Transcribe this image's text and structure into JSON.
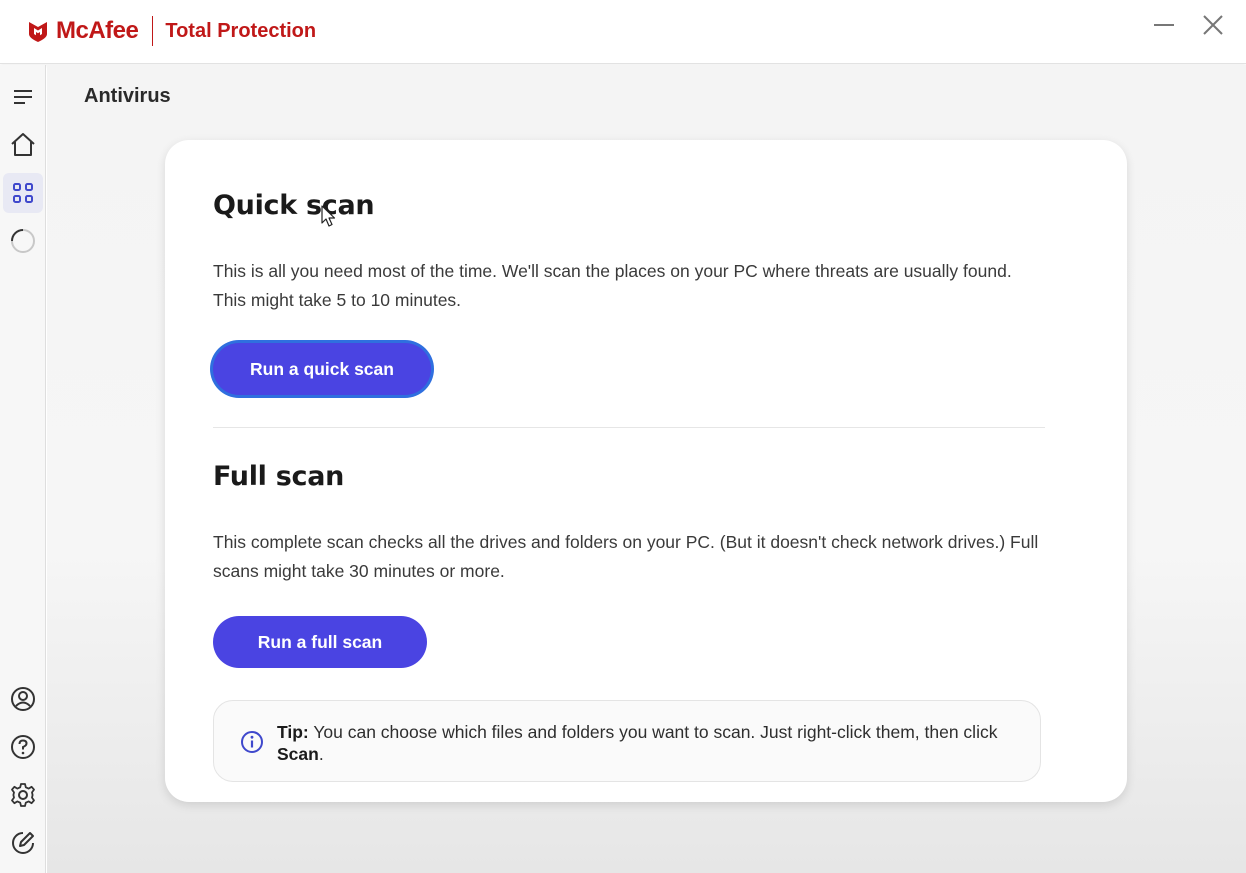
{
  "titlebar": {
    "brand_name": "McAfee",
    "product_name": "Total Protection",
    "minimize_icon": "minimize-icon",
    "close_icon": "close-icon"
  },
  "sidebar": {
    "items": [
      {
        "icon": "menu-icon"
      },
      {
        "icon": "home-icon"
      },
      {
        "icon": "apps-grid-icon",
        "active": true
      },
      {
        "icon": "scan-progress-icon"
      },
      {
        "icon": "account-icon"
      },
      {
        "icon": "help-icon"
      },
      {
        "icon": "settings-icon"
      },
      {
        "icon": "feedback-icon"
      }
    ]
  },
  "main": {
    "page_title": "Antivirus",
    "quick_scan": {
      "title": "Quick scan",
      "description": "This is all you need most of the time. We'll scan the places on your PC where threats are usually found. This might take 5 to 10 minutes.",
      "button_label": "Run a quick scan"
    },
    "full_scan": {
      "title": "Full scan",
      "description": "This complete scan checks all the drives and folders on your PC. (But it doesn't check network drives.) Full scans might take 30 minutes or more.",
      "button_label": "Run a full scan"
    },
    "tip": {
      "label": "Tip:",
      "text": "You can choose which files and folders you want to scan. Just right-click them, then click",
      "emphasis": "Scan",
      "suffix": "."
    }
  },
  "colors": {
    "brand": "#c01818",
    "primary_button": "#4a44e2",
    "active_nav": "#3f48cc"
  }
}
